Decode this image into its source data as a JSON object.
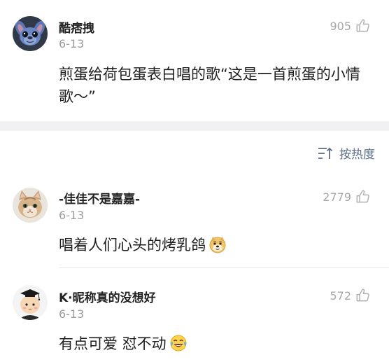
{
  "sort": {
    "label": "按热度",
    "icon": "sort-icon",
    "color": "#5d6f89"
  },
  "comments": [
    {
      "username": "酷痞拽",
      "date": "6-13",
      "likes": "905",
      "text": "煎蛋给荷包蛋表白唱的歌“这是一首煎蛋的小情歌～”",
      "avatar": "stitch-avatar-icon"
    },
    {
      "username": "-佳佳不是嘉嘉-",
      "date": "6-13",
      "likes": "2779",
      "text": "唱着人们心头的烤乳鸽",
      "emoji": "doge-emoji-icon",
      "avatar": "cat-avatar-icon"
    },
    {
      "username": "K·昵称真的没想好",
      "date": "6-13",
      "likes": "572",
      "text": "有点可爱 怼不动",
      "emoji": "laugh-cry-emoji-icon",
      "avatar": "cartoon-baby-avatar-icon"
    }
  ],
  "colors": {
    "username": "#222222",
    "meta": "#9c9c9c",
    "separator": "#f1f1f3"
  }
}
